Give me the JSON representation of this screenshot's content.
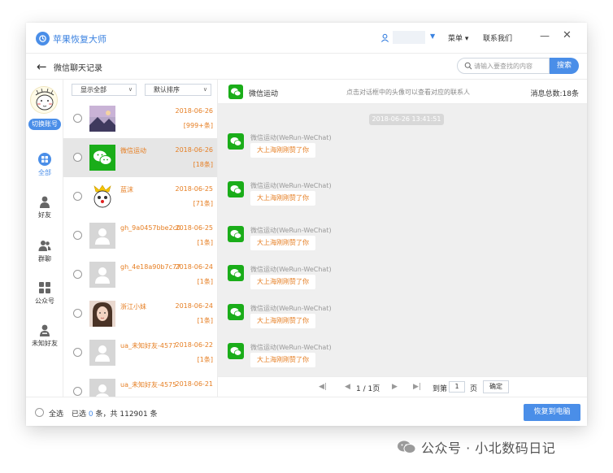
{
  "app": {
    "title": "苹果恢复大师"
  },
  "titlebar": {
    "menu_label": "菜单 ▾",
    "contact_label": "联系我们",
    "minimize": "—",
    "close": "✕",
    "user_caret": "▼"
  },
  "subheader": {
    "title": "微信聊天记录",
    "search_placeholder": "请输入要查找的内容",
    "search_button": "搜索"
  },
  "leftnav": {
    "switch_account": "切换账号",
    "items": [
      {
        "label": "全部",
        "icon": "grid-icon",
        "active": true
      },
      {
        "label": "好友",
        "icon": "person-icon",
        "active": false
      },
      {
        "label": "群聊",
        "icon": "group-icon",
        "active": false
      },
      {
        "label": "公众号",
        "icon": "apps-icon",
        "active": false
      },
      {
        "label": "未知好友",
        "icon": "unknown-person-icon",
        "active": false
      }
    ]
  },
  "contacts": {
    "filter_show": "显示全部",
    "filter_sort": "默认排序",
    "rows": [
      {
        "name": "",
        "date": "2018-06-26",
        "count": "[999+条]",
        "avatar": "landscape"
      },
      {
        "name": "微信运动",
        "date": "2018-06-26",
        "count": "[18条]",
        "avatar": "werun"
      },
      {
        "name": "蓝沫",
        "date": "2018-06-25",
        "count": "[71条]",
        "avatar": "cartoon"
      },
      {
        "name": "gh_9a0457bbe2c0",
        "date": "2018-06-25",
        "count": "[1条]",
        "avatar": "gray"
      },
      {
        "name": "gh_4e18a90b7c77",
        "date": "2018-06-24",
        "count": "[1条]",
        "avatar": "gray"
      },
      {
        "name": "浙江小妹",
        "date": "2018-06-24",
        "count": "[1条]",
        "avatar": "photo"
      },
      {
        "name": "ua_未知好友-4577",
        "date": "2018-06-22",
        "count": "[1条]",
        "avatar": "gray"
      },
      {
        "name": "ua_未知好友-4575",
        "date": "2018-06-21",
        "count": "",
        "avatar": "gray"
      }
    ]
  },
  "chat": {
    "name": "微信运动",
    "hint": "点击对话框中的头像可以查看对应的联系人",
    "total": "消息总数:18条",
    "time": "2018-06-26 13:41:51",
    "messages": [
      {
        "sender": "微信运动(WeRun-WeChat)",
        "text": "大上海刚刚赞了你"
      },
      {
        "sender": "微信运动(WeRun-WeChat)",
        "text": "大上海刚刚赞了你"
      },
      {
        "sender": "微信运动(WeRun-WeChat)",
        "text": "大上海刚刚赞了你"
      },
      {
        "sender": "微信运动(WeRun-WeChat)",
        "text": "大上海刚刚赞了你"
      },
      {
        "sender": "微信运动(WeRun-WeChat)",
        "text": "大上海刚刚赞了你"
      },
      {
        "sender": "微信运动(WeRun-WeChat)",
        "text": "大上海刚刚赞了你"
      }
    ],
    "pager": {
      "first": "◀|",
      "prev": "◀",
      "page_info": "1 / 1页",
      "next": "▶",
      "last": "▶|",
      "goto": "到第",
      "page_value": "1",
      "page_unit": "页",
      "confirm": "确定"
    }
  },
  "footer": {
    "select_all": "全选",
    "selected_prefix": "已选",
    "selected_count": "0",
    "selected_suffix": "条，共 112901 条",
    "restore_button": "恢复到电脑"
  },
  "watermark": {
    "text": "公众号 · 小北数码日记"
  },
  "colors": {
    "accent": "#4a8ee8",
    "wechat_green": "#1aad19",
    "orange": "#e67e22"
  }
}
